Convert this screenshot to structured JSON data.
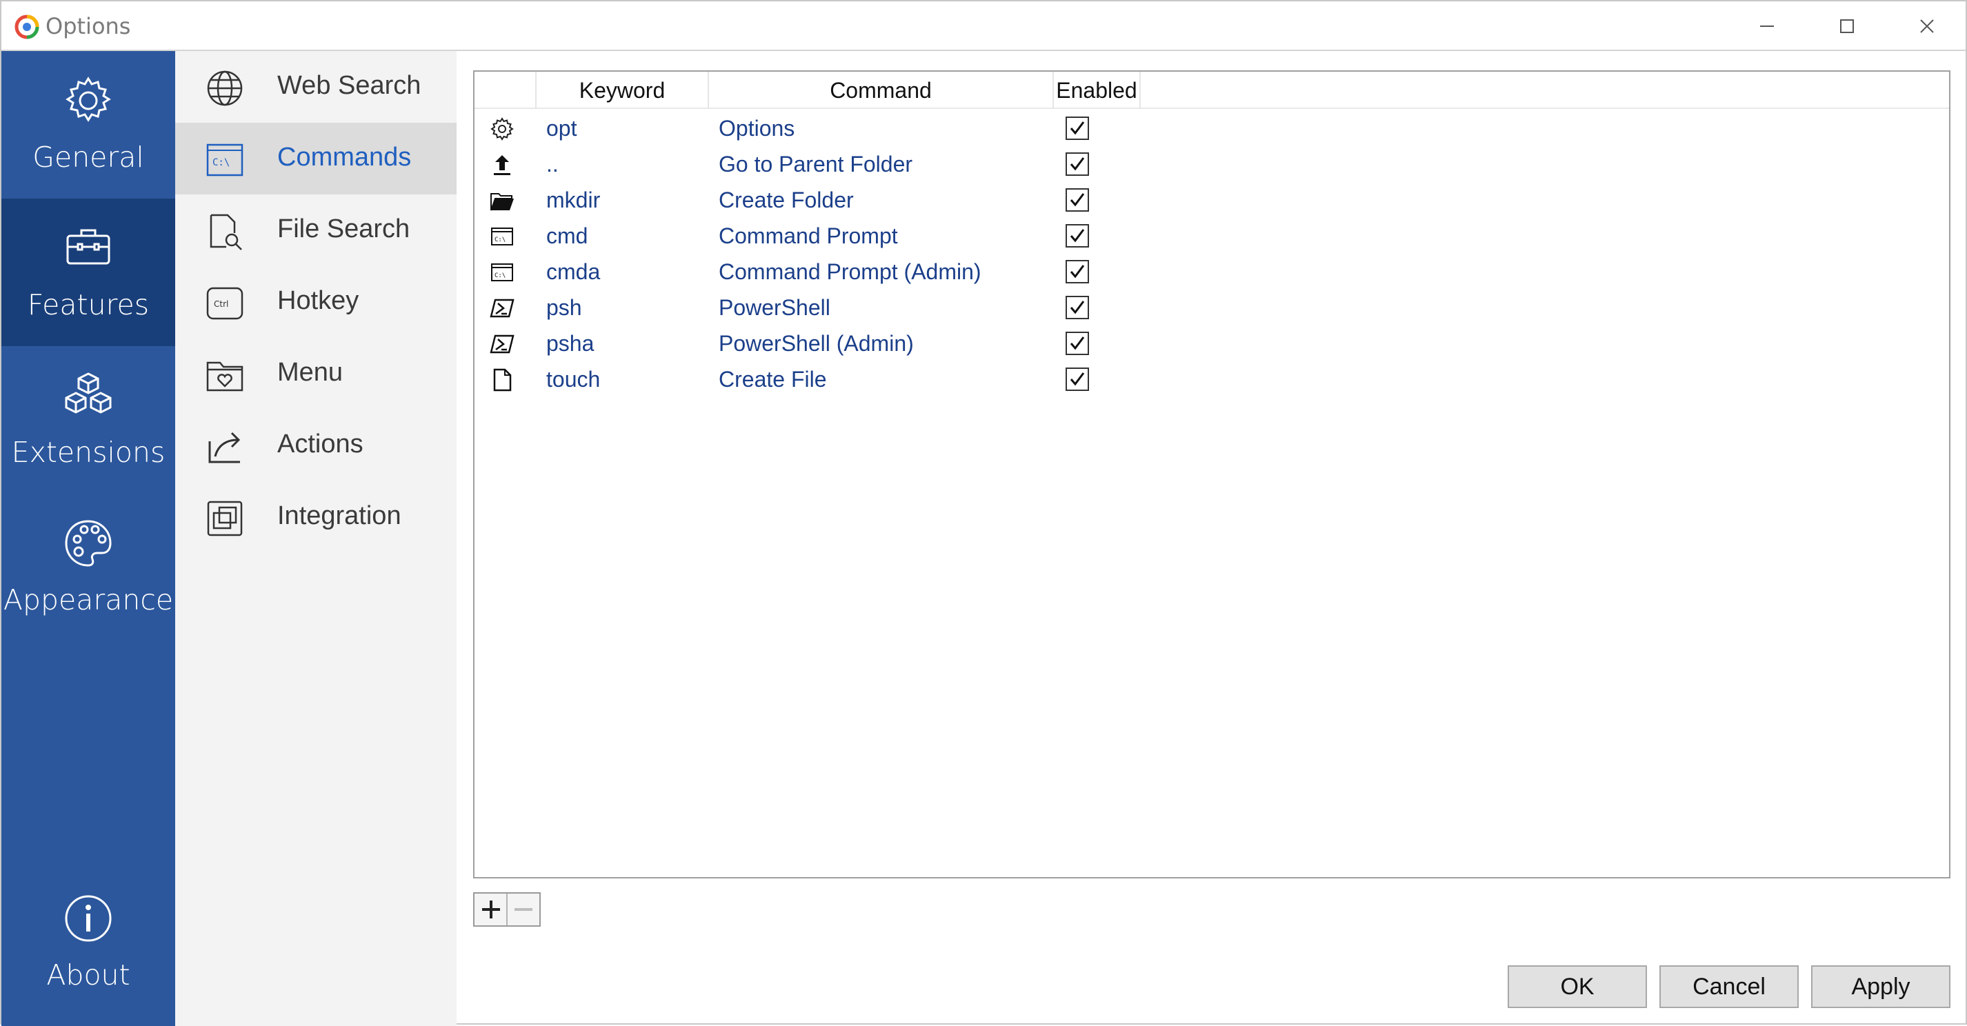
{
  "window": {
    "title": "Options"
  },
  "rail": {
    "items": [
      {
        "label": "General",
        "icon": "gear-icon",
        "active": false
      },
      {
        "label": "Features",
        "icon": "toolbox-icon",
        "active": true
      },
      {
        "label": "Extensions",
        "icon": "cubes-icon",
        "active": false
      },
      {
        "label": "Appearance",
        "icon": "palette-icon",
        "active": false
      }
    ],
    "about": {
      "label": "About",
      "icon": "info-icon"
    }
  },
  "subnav": {
    "items": [
      {
        "label": "Web Search",
        "icon": "globe-icon"
      },
      {
        "label": "Commands",
        "icon": "command-prompt-icon",
        "active": true
      },
      {
        "label": "File Search",
        "icon": "file-search-icon"
      },
      {
        "label": "Hotkey",
        "icon": "ctrl-key-icon"
      },
      {
        "label": "Menu",
        "icon": "menu-folder-icon"
      },
      {
        "label": "Actions",
        "icon": "share-arrow-icon"
      },
      {
        "label": "Integration",
        "icon": "windows-stack-icon"
      }
    ]
  },
  "table": {
    "headers": {
      "keyword": "Keyword",
      "command": "Command",
      "enabled": "Enabled"
    },
    "rows": [
      {
        "icon": "gear-icon",
        "keyword": "opt",
        "command": "Options",
        "enabled": true
      },
      {
        "icon": "upload-arrow-icon",
        "keyword": "..",
        "command": "Go to Parent Folder",
        "enabled": true
      },
      {
        "icon": "open-folder-icon",
        "keyword": "mkdir",
        "command": "Create Folder",
        "enabled": true
      },
      {
        "icon": "cmd-icon",
        "keyword": "cmd",
        "command": "Command Prompt",
        "enabled": true
      },
      {
        "icon": "cmd-icon",
        "keyword": "cmda",
        "command": "Command Prompt (Admin)",
        "enabled": true
      },
      {
        "icon": "powershell-icon",
        "keyword": "psh",
        "command": "PowerShell",
        "enabled": true
      },
      {
        "icon": "powershell-icon",
        "keyword": "psha",
        "command": "PowerShell (Admin)",
        "enabled": true
      },
      {
        "icon": "file-icon",
        "keyword": "touch",
        "command": "Create File",
        "enabled": true
      }
    ]
  },
  "buttons": {
    "ok": "OK",
    "cancel": "Cancel",
    "apply": "Apply"
  }
}
